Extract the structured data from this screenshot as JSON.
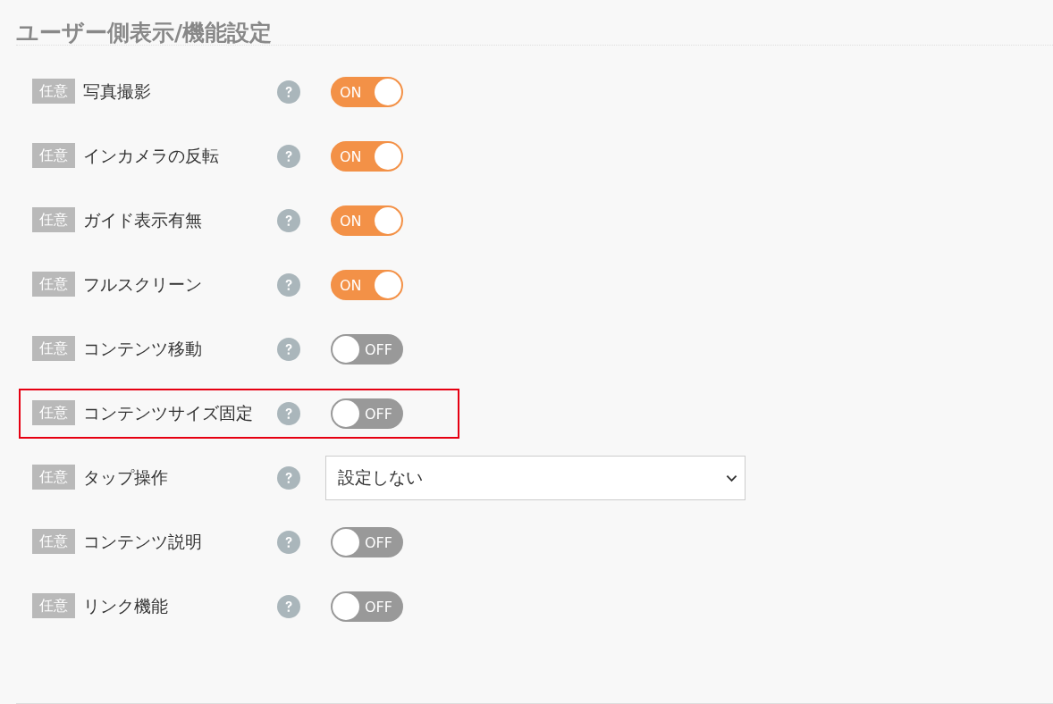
{
  "section": {
    "title": "ユーザー側表示/機能設定"
  },
  "settings": [
    {
      "kind": "toggle",
      "badge": "任意",
      "label": "写真撮影",
      "on": true,
      "state_text": "ON",
      "highlighted": false
    },
    {
      "kind": "toggle",
      "badge": "任意",
      "label": "インカメラの反転",
      "on": true,
      "state_text": "ON",
      "highlighted": false
    },
    {
      "kind": "toggle",
      "badge": "任意",
      "label": "ガイド表示有無",
      "on": true,
      "state_text": "ON",
      "highlighted": false
    },
    {
      "kind": "toggle",
      "badge": "任意",
      "label": "フルスクリーン",
      "on": true,
      "state_text": "ON",
      "highlighted": false
    },
    {
      "kind": "toggle",
      "badge": "任意",
      "label": "コンテンツ移動",
      "on": false,
      "state_text": "OFF",
      "highlighted": false
    },
    {
      "kind": "toggle",
      "badge": "任意",
      "label": "コンテンツサイズ固定",
      "on": false,
      "state_text": "OFF",
      "highlighted": true
    },
    {
      "kind": "select",
      "badge": "任意",
      "label": "タップ操作",
      "value": "設定しない",
      "highlighted": false
    },
    {
      "kind": "toggle",
      "badge": "任意",
      "label": "コンテンツ説明",
      "on": false,
      "state_text": "OFF",
      "highlighted": false
    },
    {
      "kind": "toggle",
      "badge": "任意",
      "label": "リンク機能",
      "on": false,
      "state_text": "OFF",
      "highlighted": false
    }
  ]
}
